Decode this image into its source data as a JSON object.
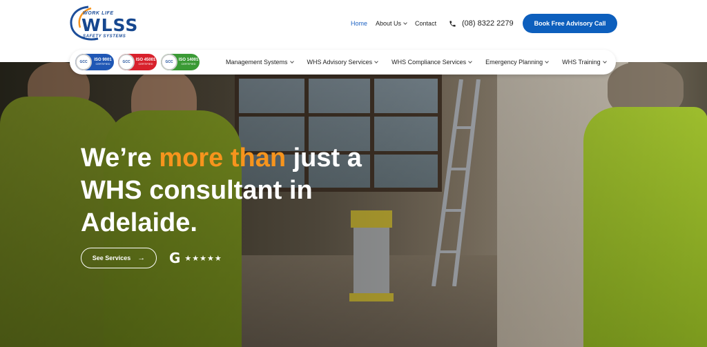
{
  "logo": {
    "tagline": "WORK LIFE",
    "brand": "WLSS",
    "sub": "SAFETY SYSTEMS"
  },
  "topnav": {
    "items": [
      {
        "label": "Home",
        "active": true,
        "has_dropdown": false
      },
      {
        "label": "About Us",
        "active": false,
        "has_dropdown": true
      },
      {
        "label": "Contact",
        "active": false,
        "has_dropdown": false
      }
    ],
    "phone": "(08) 8322 2279",
    "cta_label": "Book Free Advisory Call"
  },
  "badges": [
    {
      "seal": "GCC",
      "title": "ISO 9001",
      "subtitle": "CERTIFIED",
      "color": "#1f57b5"
    },
    {
      "seal": "GCC",
      "title": "ISO 45001",
      "subtitle": "CERTIFIED",
      "color": "#d8212c"
    },
    {
      "seal": "GCC",
      "title": "ISO 14001",
      "subtitle": "CERTIFIED",
      "color": "#3a9a35"
    }
  ],
  "subnav": {
    "items": [
      {
        "label": "Management Systems"
      },
      {
        "label": "WHS Advisory Services"
      },
      {
        "label": "WHS Compliance Services"
      },
      {
        "label": "Emergency Planning"
      },
      {
        "label": "WHS Training"
      }
    ]
  },
  "hero": {
    "headline_pre": "We’re ",
    "headline_accent": "more than",
    "headline_post": " just a WHS consultant in Adelaide.",
    "services_button": "See Services",
    "services_arrow": "→",
    "google_mark": "G",
    "stars": "★★★★★"
  },
  "colors": {
    "accent": "#f7941d",
    "brand_blue": "#0d5fbd",
    "active_nav": "#1c62c3"
  }
}
